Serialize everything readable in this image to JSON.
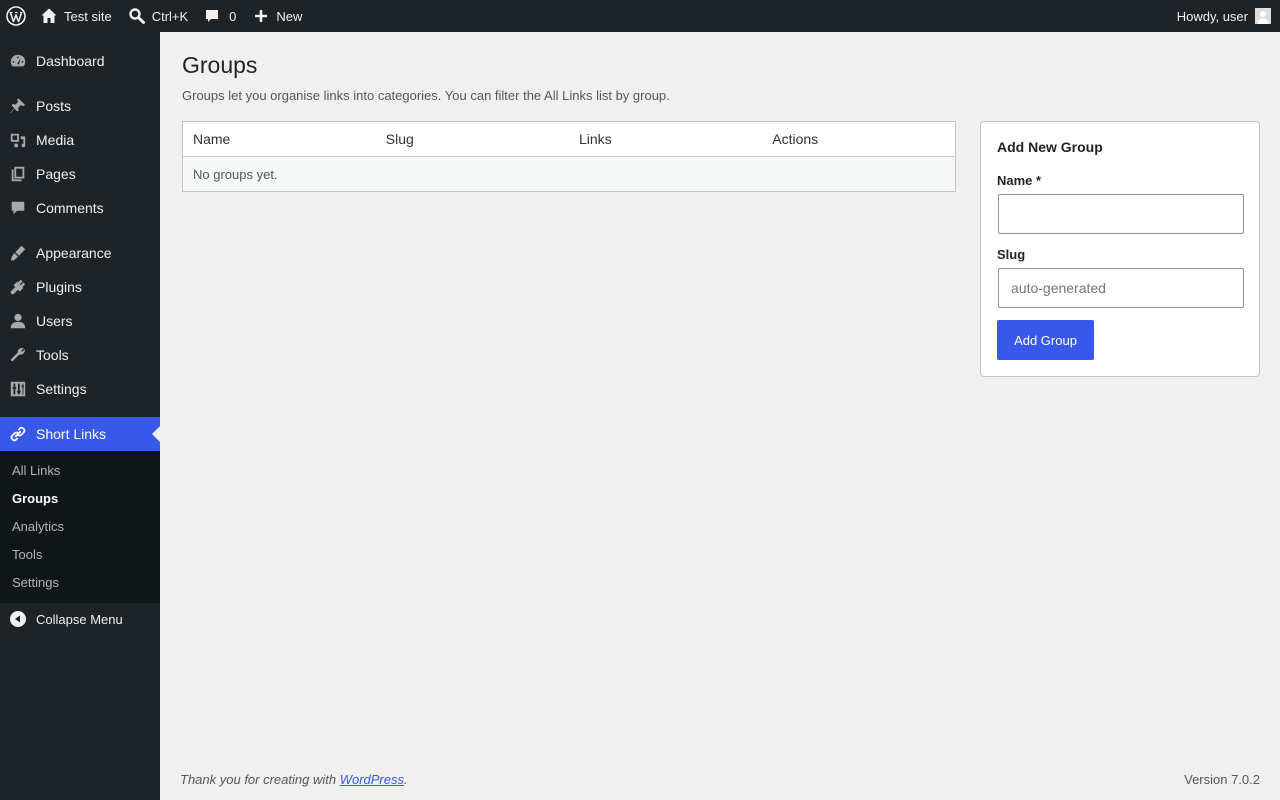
{
  "admin_bar": {
    "site_name": "Test site",
    "search_shortcut": "Ctrl+K",
    "comments_count": "0",
    "new_label": "New",
    "howdy": "Howdy, user"
  },
  "sidebar": {
    "items": [
      {
        "label": "Dashboard",
        "icon": "dashboard-icon"
      },
      {
        "label": "Posts",
        "icon": "pin-icon"
      },
      {
        "label": "Media",
        "icon": "media-icon"
      },
      {
        "label": "Pages",
        "icon": "pages-icon"
      },
      {
        "label": "Comments",
        "icon": "comment-icon"
      },
      {
        "label": "Appearance",
        "icon": "brush-icon"
      },
      {
        "label": "Plugins",
        "icon": "plug-icon"
      },
      {
        "label": "Users",
        "icon": "user-icon"
      },
      {
        "label": "Tools",
        "icon": "wrench-icon"
      },
      {
        "label": "Settings",
        "icon": "sliders-icon"
      },
      {
        "label": "Short Links",
        "icon": "link-icon"
      }
    ],
    "submenu": [
      "All Links",
      "Groups",
      "Analytics",
      "Tools",
      "Settings"
    ],
    "collapse_label": "Collapse Menu"
  },
  "page": {
    "title": "Groups",
    "description": "Groups let you organise links into categories. You can filter the All Links list by group."
  },
  "table": {
    "columns": [
      "Name",
      "Slug",
      "Links",
      "Actions"
    ],
    "empty_message": "No groups yet."
  },
  "add_group": {
    "heading": "Add New Group",
    "name_label": "Name *",
    "name_value": "",
    "slug_label": "Slug",
    "slug_placeholder": "auto-generated",
    "button_label": "Add Group"
  },
  "footer": {
    "thanks_prefix": "Thank you for creating with ",
    "wordpress_link": "WordPress",
    "thanks_suffix": ".",
    "version": "Version 7.0.2"
  },
  "colors": {
    "accent": "#3858e9",
    "admin_bar_bg": "#1d2327",
    "submenu_bg": "#101517"
  }
}
